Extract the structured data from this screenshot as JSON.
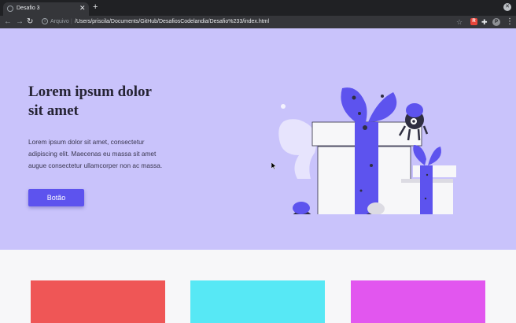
{
  "browser": {
    "tab_title": "Desafio 3",
    "tab_close": "✕",
    "new_tab": "+",
    "window_close": "✕",
    "back": "←",
    "forward": "→",
    "reload": "↻",
    "info": "i",
    "security_label": "Arquivo",
    "separator": "|",
    "url": "/Users/priscila/Documents/GitHub/DesafiosCodelandia/Desafio%233/index.html",
    "star": "☆",
    "extension_label": "R",
    "puzzle": "✚",
    "profile_initial": "P",
    "menu": "⋮"
  },
  "hero": {
    "title": "Lorem ipsum dolor sit amet",
    "text": "Lorem ipsum dolor sit amet, consectetur adipiscing elit. Maecenas eu massa sit amet augue consectetur ullamcorper non ac massa.",
    "button_label": "Botão"
  },
  "colors": {
    "hero_bg": "#c9c3fb",
    "accent": "#5d53ee",
    "card_red": "#ef5656",
    "card_cyan": "#57e8f5",
    "card_magenta": "#e256ef"
  }
}
